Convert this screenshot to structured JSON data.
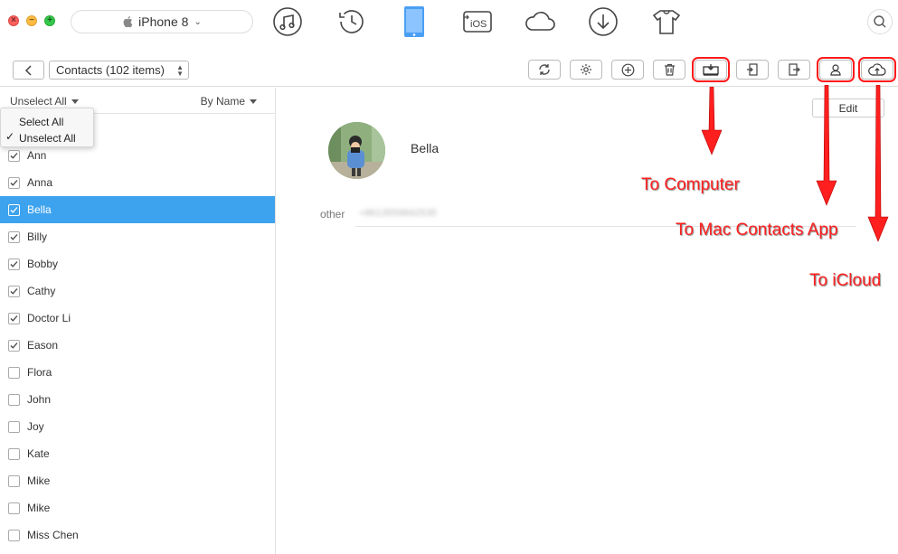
{
  "titlebar": {
    "device": "iPhone 8",
    "nav_icons": [
      "music-icon",
      "history-icon",
      "device-icon",
      "to-ios-icon",
      "cloud-icon",
      "download-icon",
      "tshirt-icon",
      "search-icon"
    ],
    "to_ios_label": "iOS"
  },
  "toolbar": {
    "category": "Contacts (102 items)",
    "tools": [
      "refresh-icon",
      "settings-icon",
      "add-icon",
      "delete-icon",
      "to-computer-icon",
      "import-icon",
      "export-icon",
      "to-contacts-icon",
      "to-icloud-icon"
    ]
  },
  "list": {
    "select_toggle": "Unselect All",
    "sort": "By Name",
    "dropdown": {
      "items": [
        "Select All",
        "Unselect All"
      ],
      "checked": "Unselect All"
    },
    "contacts": [
      {
        "name": "Ann",
        "checked": true,
        "selected": false
      },
      {
        "name": "Anna",
        "checked": true,
        "selected": false
      },
      {
        "name": "Bella",
        "checked": true,
        "selected": true
      },
      {
        "name": "Billy",
        "checked": true,
        "selected": false
      },
      {
        "name": "Bobby",
        "checked": true,
        "selected": false
      },
      {
        "name": "Cathy",
        "checked": true,
        "selected": false
      },
      {
        "name": "Doctor Li",
        "checked": true,
        "selected": false
      },
      {
        "name": "Eason",
        "checked": true,
        "selected": false
      },
      {
        "name": "Flora",
        "checked": false,
        "selected": false
      },
      {
        "name": "John",
        "checked": false,
        "selected": false
      },
      {
        "name": "Joy",
        "checked": false,
        "selected": false
      },
      {
        "name": "Kate",
        "checked": false,
        "selected": false
      },
      {
        "name": "Mike",
        "checked": false,
        "selected": false
      },
      {
        "name": "Mike",
        "checked": false,
        "selected": false
      },
      {
        "name": "Miss Chen",
        "checked": false,
        "selected": false
      }
    ]
  },
  "detail": {
    "edit_label": "Edit",
    "name": "Bella",
    "field_label": "other",
    "field_value": "+8613559842535"
  },
  "annotations": {
    "to_computer": "To Computer",
    "to_mac_contacts": "To Mac Contacts App",
    "to_icloud": "To iCloud"
  },
  "colors": {
    "selection": "#3ea3ee",
    "annotation": "#ff1f1f",
    "device_icon": "#4a9ff5"
  }
}
